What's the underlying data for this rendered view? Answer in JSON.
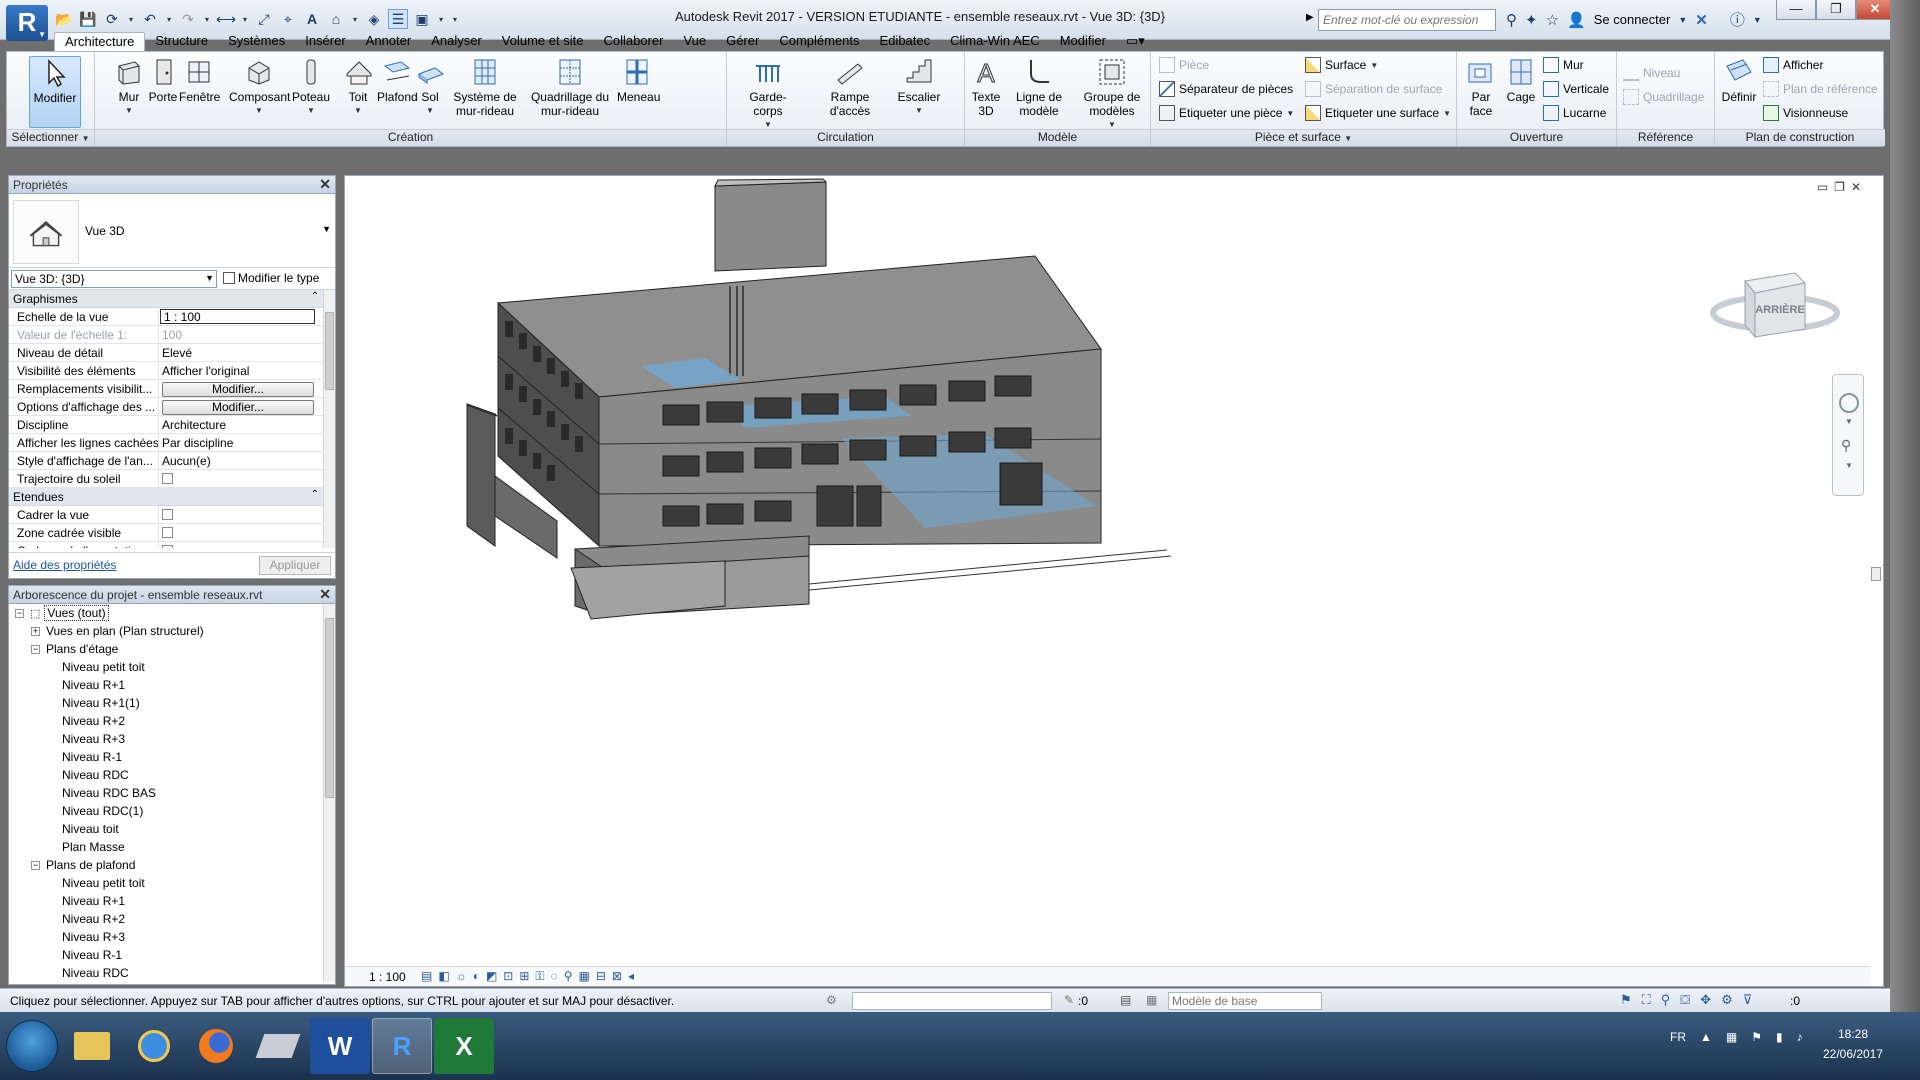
{
  "window": {
    "title": "Autodesk Revit 2017 - VERSION ETUDIANTE -        ensemble reseaux.rvt - Vue 3D: {3D}",
    "search_placeholder": "Entrez mot-clé ou expression",
    "connect_label": "Se connecter",
    "app_letter": "R"
  },
  "ribbon_tabs": [
    "Architecture",
    "Structure",
    "Systèmes",
    "Insérer",
    "Annoter",
    "Analyser",
    "Volume et site",
    "Collaborer",
    "Vue",
    "Gérer",
    "Compléments",
    "Edibatec",
    "Clima-Win AEC",
    "Modifier"
  ],
  "ribbon": {
    "select_group": {
      "label": "Sélectionner",
      "modify": "Modifier"
    },
    "creation": {
      "label": "Création",
      "buttons": [
        "Mur",
        "Porte",
        "Fenêtre",
        "Composant",
        "Poteau",
        "Toit",
        "Plafond",
        "Sol",
        "Système de mur-rideau",
        "Quadrillage du mur-rideau",
        "Meneau"
      ]
    },
    "circulation": {
      "label": "Circulation",
      "buttons": [
        "Garde-corps",
        "Rampe d'accès",
        "Escalier"
      ]
    },
    "modele": {
      "label": "Modèle",
      "buttons": [
        "Texte 3D",
        "Ligne de modèle",
        "Groupe de modèles"
      ]
    },
    "piece_surface": {
      "label": "Pièce et surface",
      "items": [
        "Pièce",
        "Séparateur de pièces",
        "Etiqueter  une pièce",
        "Surface",
        "Séparation  de surface",
        "Etiqueter  une surface"
      ]
    },
    "ouverture": {
      "label": "Ouverture",
      "buttons": [
        "Par face",
        "Cage"
      ],
      "small": [
        "Mur",
        "Verticale",
        "Lucarne"
      ]
    },
    "reference": {
      "label": "Référence",
      "items": [
        "Niveau",
        "Quadrillage"
      ]
    },
    "plan_construction": {
      "label": "Plan de construction",
      "define": "Définir",
      "items": [
        "Afficher",
        "Plan de référence",
        "Visionneuse"
      ]
    }
  },
  "properties": {
    "title": "Propriétés",
    "type_name": "Vue 3D",
    "instance": "Vue 3D: {3D}",
    "edit_type": "Modifier le type",
    "sections": [
      {
        "name": "Graphismes",
        "rows": [
          {
            "key": "Echelle de la vue",
            "value": "1 : 100"
          },
          {
            "key": "Valeur de l'échelle    1:",
            "value": "100"
          },
          {
            "key": "Niveau de détail",
            "value": "Elevé"
          },
          {
            "key": "Visibilité des éléments",
            "value": "Afficher l'original"
          },
          {
            "key": "Remplacements visibilit...",
            "value": "Modifier..."
          },
          {
            "key": "Options d'affichage des ...",
            "value": "Modifier..."
          },
          {
            "key": "Discipline",
            "value": "Architecture"
          },
          {
            "key": "Afficher les lignes cachées",
            "value": "Par discipline"
          },
          {
            "key": "Style d'affichage de l'an...",
            "value": "Aucun(e)"
          },
          {
            "key": "Trajectoire du soleil",
            "value": ""
          }
        ]
      },
      {
        "name": "Etendues",
        "rows": [
          {
            "key": "Cadrer la vue",
            "value": ""
          },
          {
            "key": "Zone cadrée visible",
            "value": ""
          },
          {
            "key": "Cadrage de l'annotation",
            "value": ""
          }
        ]
      }
    ],
    "help_link": "Aide des propriétés",
    "apply": "Appliquer"
  },
  "browser": {
    "title": "Arborescence du projet - ensemble reseaux.rvt",
    "nodes": [
      {
        "label": "Vues (tout)",
        "level": 0,
        "toggle": "-"
      },
      {
        "label": "Vues en plan (Plan structurel)",
        "level": 1,
        "toggle": "+"
      },
      {
        "label": "Plans d'étage",
        "level": 1,
        "toggle": "-"
      },
      {
        "label": "Niveau petit toit",
        "level": 2
      },
      {
        "label": "Niveau R+1",
        "level": 2
      },
      {
        "label": "Niveau R+1(1)",
        "level": 2
      },
      {
        "label": "Niveau R+2",
        "level": 2
      },
      {
        "label": "Niveau R+3",
        "level": 2
      },
      {
        "label": "Niveau R-1",
        "level": 2
      },
      {
        "label": "Niveau RDC",
        "level": 2
      },
      {
        "label": "Niveau RDC BAS",
        "level": 2
      },
      {
        "label": "Niveau RDC(1)",
        "level": 2
      },
      {
        "label": "Niveau toit",
        "level": 2
      },
      {
        "label": "Plan Masse",
        "level": 2
      },
      {
        "label": "Plans de plafond",
        "level": 1,
        "toggle": "-"
      },
      {
        "label": "Niveau petit toit",
        "level": 2
      },
      {
        "label": "Niveau R+1",
        "level": 2
      },
      {
        "label": "Niveau R+2",
        "level": 2
      },
      {
        "label": "Niveau R+3",
        "level": 2
      },
      {
        "label": "Niveau R-1",
        "level": 2
      },
      {
        "label": "Niveau RDC",
        "level": 2
      }
    ]
  },
  "viewport": {
    "scale": "1 : 100",
    "viewcube_face": "ARRIÈRE"
  },
  "statusbar": {
    "text": "Cliquez pour sélectionner. Appuyez sur TAB pour afficher d'autres options, sur CTRL pour ajouter et sur MAJ pour désactiver.",
    "zero_left": ":0",
    "model": "Modèle de base",
    "zero_right": ":0"
  },
  "taskbar": {
    "lang": "FR",
    "time": "18:28",
    "date": "22/06/2017",
    "apps": [
      "explorer-icon",
      "ie-icon",
      "firefox-icon",
      "sketchup-icon",
      "word-icon",
      "revit-icon",
      "excel-icon"
    ]
  },
  "colors": {
    "ribbon_bg": "#eef3f8",
    "building_wall": "#8a8a8a",
    "duct_blue": "#6fa9d6",
    "taskbar": "#2a4666"
  }
}
